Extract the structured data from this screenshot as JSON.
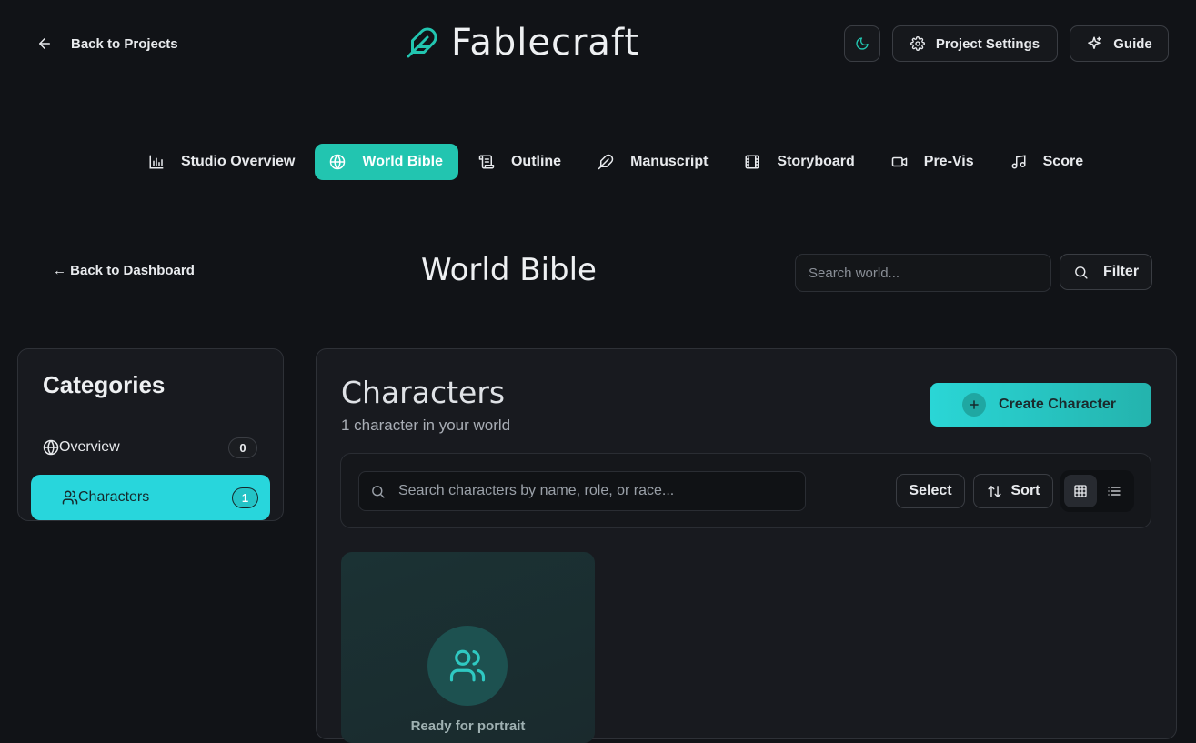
{
  "header": {
    "back_label": "Back to Projects",
    "app_title": "Fablecraft",
    "project_settings_label": "Project Settings",
    "guide_label": "Guide"
  },
  "tabs": [
    {
      "label": "Studio Overview",
      "icon": "bar-chart-icon",
      "active": false
    },
    {
      "label": "World Bible",
      "icon": "globe-icon",
      "active": true
    },
    {
      "label": "Outline",
      "icon": "scroll-icon",
      "active": false
    },
    {
      "label": "Manuscript",
      "icon": "feather-icon",
      "active": false
    },
    {
      "label": "Storyboard",
      "icon": "film-icon",
      "active": false
    },
    {
      "label": "Pre-Vis",
      "icon": "video-icon",
      "active": false
    },
    {
      "label": "Score",
      "icon": "music-icon",
      "active": false
    }
  ],
  "world_bible": {
    "back_label": "← Back to Dashboard",
    "title": "World Bible",
    "search_placeholder": "Search world...",
    "filter_label": "Filter"
  },
  "categories": {
    "title": "Categories",
    "items": [
      {
        "label": "Overview",
        "count": "0",
        "icon": "globe-icon"
      },
      {
        "label": "Characters",
        "count": "1",
        "icon": "users-icon"
      }
    ]
  },
  "characters": {
    "title": "Characters",
    "subtitle": "1 character in your world",
    "create_label": "Create Character",
    "search_placeholder": "Search characters by name, role, or race...",
    "select_label": "Select",
    "sort_label": "Sort",
    "card_label": "Ready for portrait"
  },
  "colors": {
    "accent": "#22c5b0",
    "accent_cyan": "#2ad6d6",
    "background": "#111317",
    "panel": "#181a1f"
  }
}
